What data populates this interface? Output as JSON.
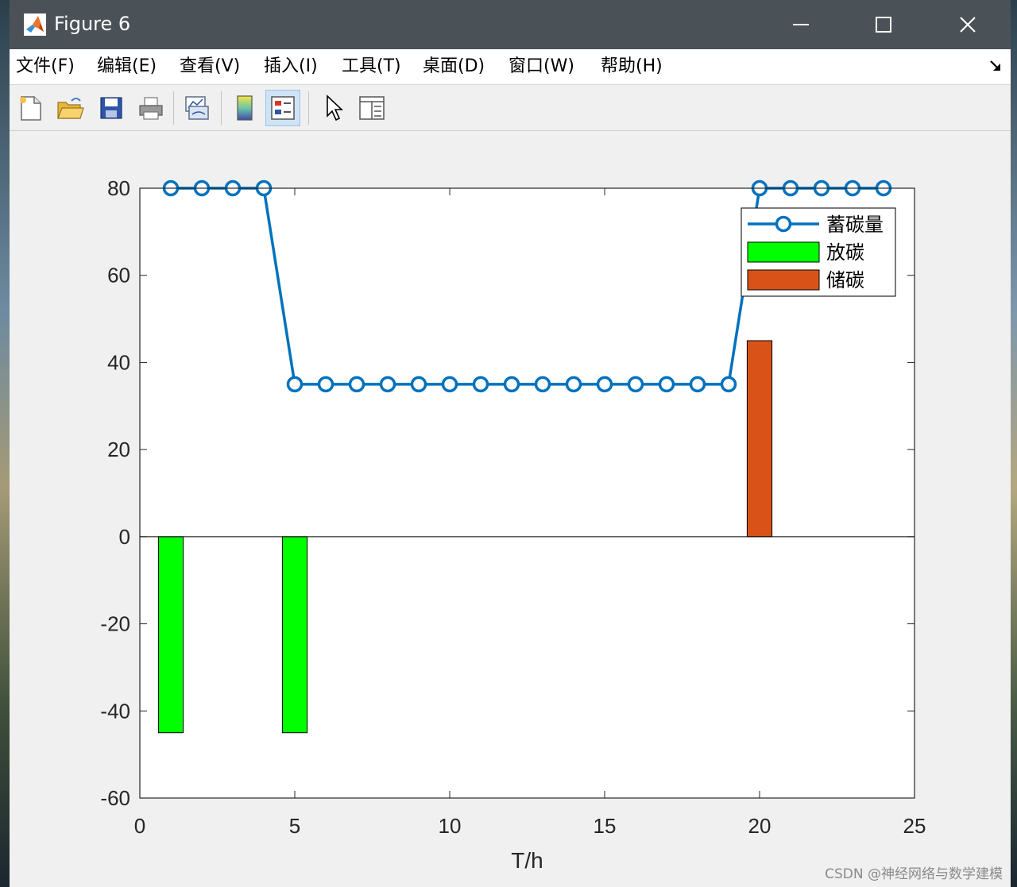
{
  "window": {
    "title": "Figure 6",
    "icon": "matlab-icon"
  },
  "menu": {
    "items": [
      "文件(F)",
      "编辑(E)",
      "查看(V)",
      "插入(I)",
      "工具(T)",
      "桌面(D)",
      "窗口(W)",
      "帮助(H)"
    ],
    "dock_icon": "dock-arrow-icon"
  },
  "toolbar": {
    "icons": [
      "new-figure-icon",
      "open-file-icon",
      "save-icon",
      "print-icon",
      "link-plot-icon",
      "colorbar-icon",
      "legend-icon",
      "pointer-icon",
      "property-inspector-icon"
    ]
  },
  "chart_data": {
    "type": "bar",
    "xlabel": "T/h",
    "ylabel": "",
    "title": "",
    "xlim": [
      0,
      25
    ],
    "ylim": [
      -60,
      80
    ],
    "xticks": [
      0,
      5,
      10,
      15,
      20,
      25
    ],
    "yticks": [
      -60,
      -40,
      -20,
      0,
      20,
      40,
      60,
      80
    ],
    "grid": false,
    "legend_position": "top-right",
    "series": [
      {
        "name": "蓄碳量",
        "kind": "line",
        "marker": "circle",
        "color": "#0072bd",
        "x": [
          1,
          2,
          3,
          4,
          5,
          6,
          7,
          8,
          9,
          10,
          11,
          12,
          13,
          14,
          15,
          16,
          17,
          18,
          19,
          20,
          21,
          22,
          23,
          24
        ],
        "y": [
          80,
          80,
          80,
          80,
          35,
          35,
          35,
          35,
          35,
          35,
          35,
          35,
          35,
          35,
          35,
          35,
          35,
          35,
          35,
          80,
          80,
          80,
          80,
          80
        ]
      },
      {
        "name": "放碳",
        "kind": "bar",
        "color": "#00ff00",
        "x": [
          1,
          5
        ],
        "y": [
          -45,
          -45
        ]
      },
      {
        "name": "储碳",
        "kind": "bar",
        "color": "#d95319",
        "x": [
          20
        ],
        "y": [
          45
        ]
      }
    ]
  },
  "watermark": "CSDN @神经网络与数学建模"
}
